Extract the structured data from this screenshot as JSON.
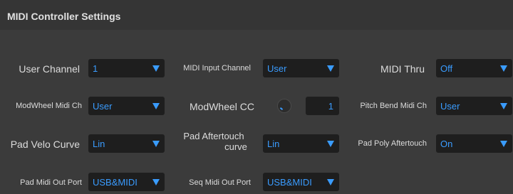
{
  "header": {
    "title": "MIDI Controller Settings"
  },
  "rows": {
    "user_channel": {
      "label": "User Channel",
      "value": "1"
    },
    "midi_input_channel": {
      "label": "MIDI Input Channel",
      "value": "User"
    },
    "midi_thru": {
      "label": "MIDI Thru",
      "value": "Off"
    },
    "modwheel_midi_ch": {
      "label": "ModWheel Midi Ch",
      "value": "User"
    },
    "modwheel_cc": {
      "label": "ModWheel CC",
      "value": "1",
      "knob_icon": "knob-icon"
    },
    "pitch_bend_midi_ch": {
      "label": "Pitch Bend Midi Ch",
      "value": "User"
    },
    "pad_velo_curve": {
      "label": "Pad Velo Curve",
      "value": "Lin"
    },
    "pad_aftertouch_curve": {
      "label_line1": "Pad Aftertouch",
      "label_line2": "curve",
      "value": "Lin"
    },
    "pad_poly_aftertouch": {
      "label": "Pad Poly Aftertouch",
      "value": "On"
    },
    "pad_midi_out_port": {
      "label": "Pad Midi Out Port",
      "value": "USB&MIDI"
    },
    "seq_midi_out_port": {
      "label": "Seq Midi Out Port",
      "value": "USB&MIDI"
    }
  },
  "colors": {
    "accent": "#3a9cff",
    "background": "#3a3a3a",
    "field": "#1e1e1e"
  }
}
